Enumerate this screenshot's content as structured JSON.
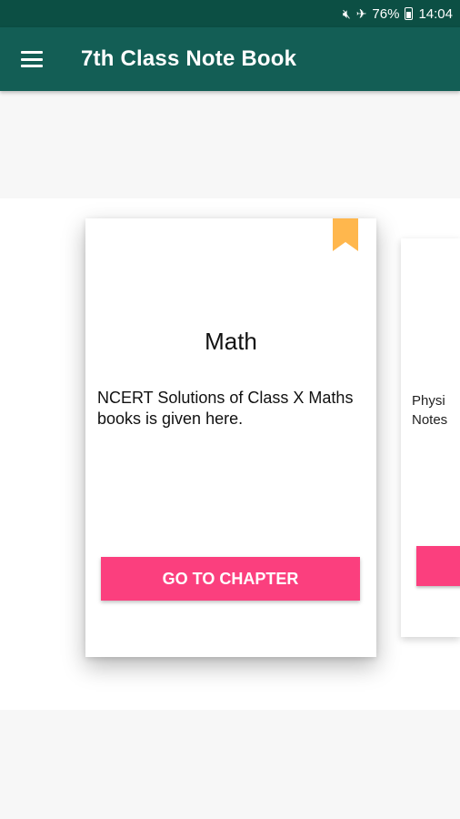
{
  "status_bar": {
    "mute_icon": "volume-mute-icon",
    "airplane_icon": "airplane-icon",
    "battery_percent": "76%",
    "time": "14:04"
  },
  "app_bar": {
    "menu_icon": "hamburger-menu-icon",
    "title": "7th Class Note Book"
  },
  "cards": [
    {
      "title": "Math",
      "description": "NCERT Solutions of Class X Maths books is given here.",
      "button_label": "GO TO CHAPTER",
      "bookmark_color": "#ffb74d"
    },
    {
      "description": "Physi\nNotes"
    }
  ],
  "colors": {
    "status_bar": "#0c4f44",
    "app_bar": "#135e55",
    "accent_button": "#fb3f7e"
  }
}
